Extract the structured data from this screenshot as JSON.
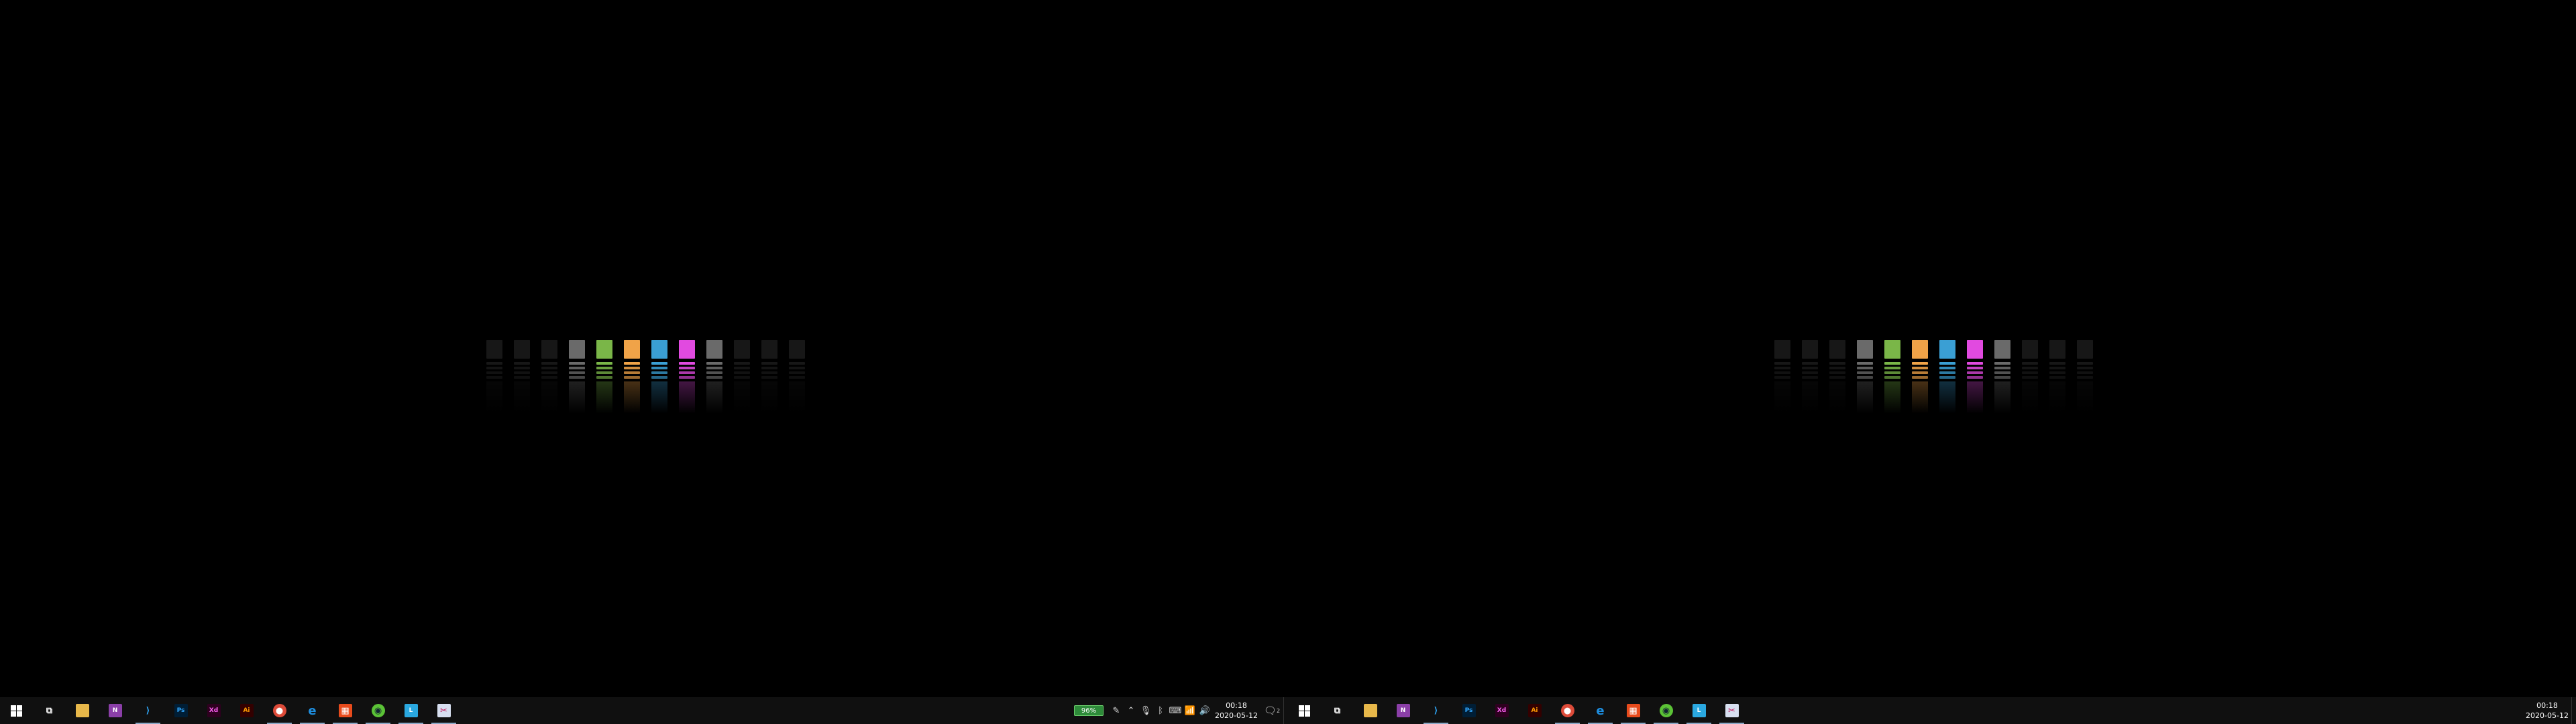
{
  "colors": {
    "taskbar": "#101010",
    "bar_dark": "#333333",
    "bar_gray": "#6a6a6a",
    "bar_green": "#7ab648",
    "bar_orange": "#f0a348",
    "bar_blue": "#3a9fd4",
    "bar_magenta": "#e14ae0"
  },
  "wallpaper": {
    "bars": [
      "dark",
      "dark",
      "dark",
      "gray",
      "green",
      "orange",
      "blue",
      "magenta",
      "gray",
      "dark",
      "dark",
      "dark"
    ]
  },
  "taskbar_apps": [
    {
      "name": "start",
      "icon": "windows-logo-icon",
      "running": false
    },
    {
      "name": "task-view",
      "icon": "task-view-icon",
      "running": false
    },
    {
      "name": "file-explorer",
      "icon": "folder-icon",
      "running": false
    },
    {
      "name": "onenote",
      "icon": "onenote-icon",
      "label": "N",
      "running": false
    },
    {
      "name": "vscode",
      "icon": "vscode-icon",
      "running": true
    },
    {
      "name": "photoshop",
      "icon": "photoshop-icon",
      "label": "Ps",
      "running": false
    },
    {
      "name": "xd",
      "icon": "xd-icon",
      "label": "Xd",
      "running": false
    },
    {
      "name": "illustrator",
      "icon": "illustrator-icon",
      "label": "Ai",
      "running": false
    },
    {
      "name": "chrome",
      "icon": "chrome-icon",
      "running": true
    },
    {
      "name": "edge",
      "icon": "edge-icon",
      "label": "e",
      "running": true
    },
    {
      "name": "store",
      "icon": "store-icon",
      "running": true
    },
    {
      "name": "figma",
      "icon": "green-app-icon",
      "running": true
    },
    {
      "name": "l-app",
      "icon": "l-app-icon",
      "label": "L",
      "running": true
    },
    {
      "name": "snip",
      "icon": "snip-icon",
      "running": true
    }
  ],
  "tray": {
    "battery": "96%",
    "time": "00:18",
    "date": "2020-05-12",
    "notifications": "2"
  },
  "tray_right_monitor": {
    "time": "00:18",
    "date": "2020-05-12"
  }
}
